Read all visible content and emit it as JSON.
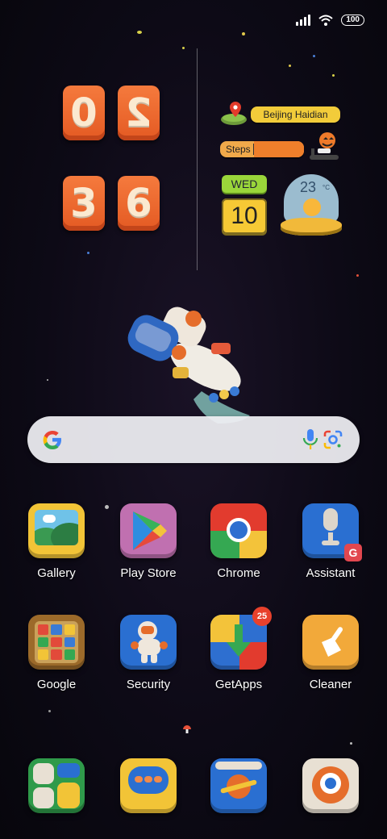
{
  "status_bar": {
    "battery": "100",
    "icons": [
      "signal-icon",
      "wifi-icon",
      "battery-icon"
    ]
  },
  "clock": {
    "digits": [
      "0",
      "2",
      "3",
      "6"
    ]
  },
  "location_widget": {
    "label": "Beijing Haidian"
  },
  "steps_widget": {
    "label": "Steps"
  },
  "calendar_widget": {
    "weekday": "WED",
    "day": "10"
  },
  "weather_widget": {
    "temperature": "23",
    "unit": "°C"
  },
  "search_bar": {
    "icons": [
      "google-logo-icon",
      "mic-icon",
      "lens-camera-icon"
    ]
  },
  "apps": [
    {
      "label": "Gallery"
    },
    {
      "label": "Play Store"
    },
    {
      "label": "Chrome"
    },
    {
      "label": "Assistant"
    },
    {
      "label": "Google"
    },
    {
      "label": "Security"
    },
    {
      "label": "GetApps",
      "badge": "25"
    },
    {
      "label": "Cleaner"
    }
  ],
  "dock": [
    "phone-icon",
    "messages-icon",
    "browser-icon",
    "camera-icon"
  ],
  "colors": {
    "clay_orange": "#f06a2f",
    "clay_yellow": "#f6c935",
    "clay_green": "#9ad63a",
    "clay_blue": "#2a6fd1",
    "clay_red": "#e43c2c"
  }
}
